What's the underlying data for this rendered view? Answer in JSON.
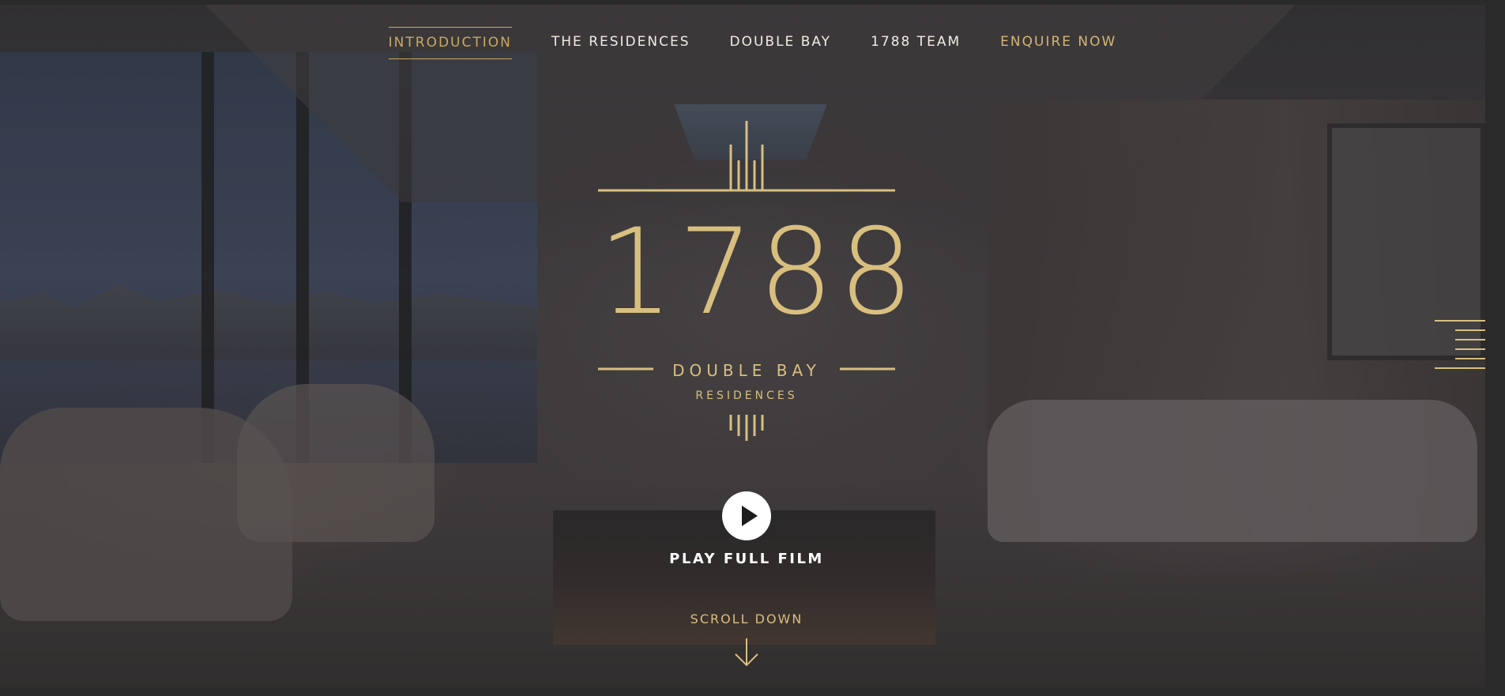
{
  "nav": {
    "items": [
      {
        "label": "INTRODUCTION"
      },
      {
        "label": "THE RESIDENCES"
      },
      {
        "label": "DOUBLE BAY"
      },
      {
        "label": "1788 TEAM"
      },
      {
        "label": "ENQUIRE NOW"
      }
    ]
  },
  "logo": {
    "number": "1788",
    "line1": "DOUBLE BAY",
    "line2": "RESIDENCES"
  },
  "film": {
    "label": "PLAY FULL FILM"
  },
  "scroll": {
    "label": "SCROLL DOWN"
  },
  "icons": {
    "play": "play-icon",
    "arrow": "arrow-down-icon",
    "menu": "hamburger-menu-icon"
  },
  "colors": {
    "gold": "#d8bf7f",
    "nav_text": "#f1ece4",
    "active_nav": "#c9a95e",
    "play_button": "#ffffff"
  }
}
